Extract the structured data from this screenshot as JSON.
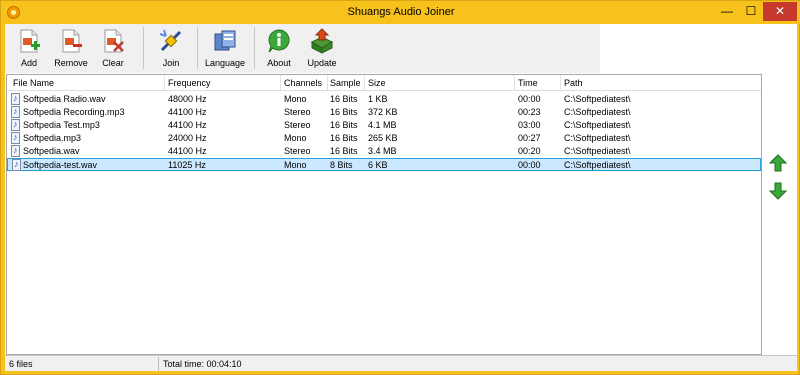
{
  "window": {
    "title": "Shuangs Audio Joiner",
    "minimize_glyph": "—",
    "maximize_glyph": "☐",
    "close_glyph": "✕"
  },
  "toolbar": {
    "add_label": "Add",
    "remove_label": "Remove",
    "clear_label": "Clear",
    "join_label": "Join",
    "language_label": "Language",
    "about_label": "About",
    "update_label": "Update"
  },
  "columns": [
    "File Name",
    "Frequency",
    "Channels",
    "Sample",
    "Size",
    "Time",
    "Path"
  ],
  "files": [
    {
      "name": "Softpedia Radio.wav",
      "frequency": "48000 Hz",
      "channels": "Mono",
      "sample": "16 Bits",
      "size": "1 KB",
      "time": "00:00",
      "path": "C:\\Softpediatest\\"
    },
    {
      "name": "Softpedia Recording.mp3",
      "frequency": "44100 Hz",
      "channels": "Stereo",
      "sample": "16 Bits",
      "size": "372 KB",
      "time": "00:23",
      "path": "C:\\Softpediatest\\"
    },
    {
      "name": "Softpedia Test.mp3",
      "frequency": "44100 Hz",
      "channels": "Stereo",
      "sample": "16 Bits",
      "size": "4.1 MB",
      "time": "03:00",
      "path": "C:\\Softpediatest\\"
    },
    {
      "name": "Softpedia.mp3",
      "frequency": "24000 Hz",
      "channels": "Mono",
      "sample": "16 Bits",
      "size": "265 KB",
      "time": "00:27",
      "path": "C:\\Softpediatest\\"
    },
    {
      "name": "Softpedia.wav",
      "frequency": "44100 Hz",
      "channels": "Stereo",
      "sample": "16 Bits",
      "size": "3.4 MB",
      "time": "00:20",
      "path": "C:\\Softpediatest\\"
    },
    {
      "name": "Softpedia-test.wav",
      "frequency": "11025 Hz",
      "channels": "Mono",
      "sample": "8 Bits",
      "size": "6 KB",
      "time": "00:00",
      "path": "C:\\Softpediatest\\"
    }
  ],
  "selected_index": 5,
  "status": {
    "file_count": "6 files",
    "total_time": "Total time: 00:04:10"
  },
  "colors": {
    "title_bar": "#f7c21c",
    "close_button": "#c7392c",
    "selection": "#cce8ff",
    "arrow_green": "#3aa83a"
  }
}
